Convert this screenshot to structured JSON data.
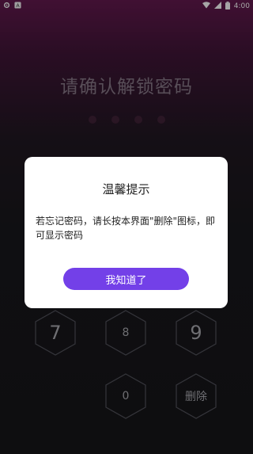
{
  "status_bar": {
    "time": "4:00",
    "left_icons": [
      "settings-icon",
      "a11y-icon"
    ],
    "right_icons": [
      "wifi-icon",
      "signal-icon",
      "battery-icon"
    ]
  },
  "lock_screen": {
    "title": "请确认解锁密码",
    "pin_dot_count": 4,
    "keys": {
      "k7": "7",
      "k8": "8",
      "k9": "9",
      "k0": "0",
      "delete": "删除"
    }
  },
  "dialog": {
    "title": "温馨提示",
    "message": "若忘记密码，请长按本界面\"删除\"图标，即可显示密码",
    "confirm_label": "我知道了"
  },
  "colors": {
    "accent": "#7340e8",
    "hex_border": "#4a4a52",
    "dot": "#3b1f33"
  }
}
